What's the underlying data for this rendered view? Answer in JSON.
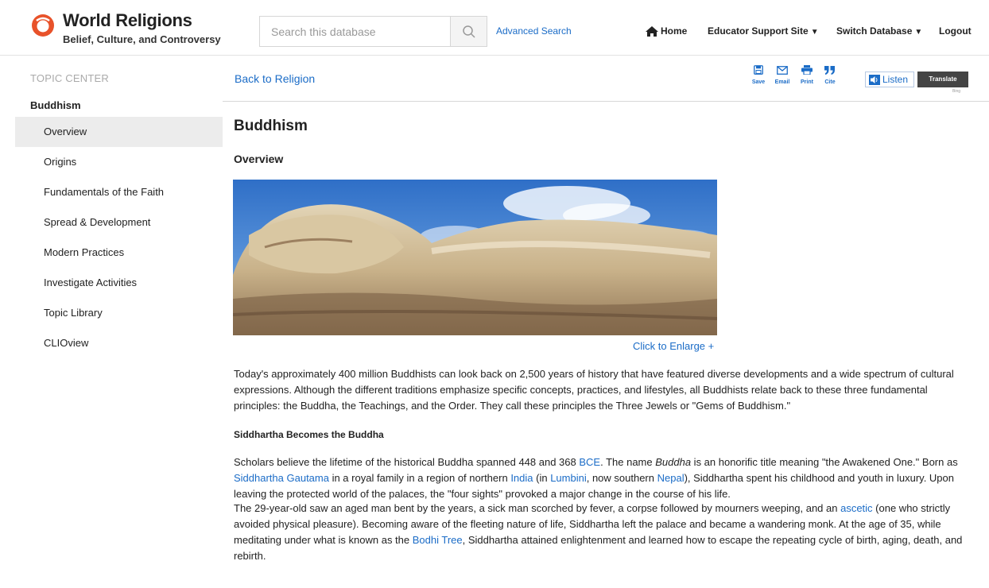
{
  "header": {
    "brand_title": "World Religions",
    "brand_subtitle": "Belief, Culture, and Controversy",
    "logo_icon": "abc-clio-logo-icon",
    "search": {
      "placeholder": "Search this database",
      "value": ""
    },
    "advanced_search_label": "Advanced Search",
    "nav": {
      "home_label": "Home",
      "educator_label": "Educator Support Site",
      "switch_label": "Switch Database",
      "logout_label": "Logout"
    }
  },
  "sidebar": {
    "topic_center_label": "TOPIC CENTER",
    "heading": "Buddhism",
    "items": [
      {
        "label": "Overview",
        "active": true
      },
      {
        "label": "Origins"
      },
      {
        "label": "Fundamentals of the Faith"
      },
      {
        "label": "Spread & Development"
      },
      {
        "label": "Modern Practices"
      },
      {
        "label": "Investigate Activities"
      },
      {
        "label": "Topic Library"
      },
      {
        "label": "CLIOview"
      }
    ]
  },
  "toolbar": {
    "back_label": "Back to Religion",
    "save_label": "Save",
    "email_label": "Email",
    "print_label": "Print",
    "cite_label": "Cite",
    "listen_label": "Listen",
    "translate_label": "Translate",
    "bing_label": "Bing"
  },
  "article": {
    "title": "Buddhism",
    "section": "Overview",
    "enlarge_label": "Click to Enlarge +",
    "p1": "Today's approximately 400 million Buddhists can look back on 2,500 years of history that have featured diverse developments and a wide spectrum of cultural expressions. Although the different traditions emphasize specific concepts, practices, and lifestyles, all Buddhists relate back to these three fundamental principles: the Buddha, the Teachings, and the Order. They call these principles the Three Jewels or \"Gems of Buddhism.\"",
    "subhead": "Siddhartha Becomes the Buddha",
    "p2": {
      "a": "Scholars believe the lifetime of the historical Buddha spanned 448 and 368 ",
      "link_bce": "BCE",
      "b": ". The name ",
      "buddha_em": "Buddha",
      "c": " is an honorific title meaning \"the Awakened One.\" Born as ",
      "link_siddhartha": "Siddhartha Gautama",
      "d": " in a royal family in a region of northern ",
      "link_india": "India",
      "e": " (in ",
      "link_lumbini": "Lumbini",
      "f": ", now southern ",
      "link_nepal": "Nepal",
      "g": "), Siddhartha spent his childhood and youth in luxury. Upon leaving the protected world of the palaces, the \"four sights\" provoked a major change in the course of his life."
    },
    "p3": {
      "a": "The 29-year-old saw an aged man bent by the years, a sick man scorched by fever, a corpse followed by mourners weeping, and an ",
      "link_ascetic": "ascetic",
      "b": " (one who strictly avoided physical pleasure). Becoming aware of the fleeting nature of life, Siddhartha left the palace and became a wandering monk. At the age of 35, while meditating under what is known as the ",
      "link_bodhi": "Bodhi Tree",
      "c": ", Siddhartha attained enlightenment and learned how to escape the repeating cycle of birth, aging, death, and rebirth."
    }
  },
  "colors": {
    "link": "#1b6cc7",
    "logo_orange": "#e8522a",
    "active_bg": "#ececec"
  }
}
